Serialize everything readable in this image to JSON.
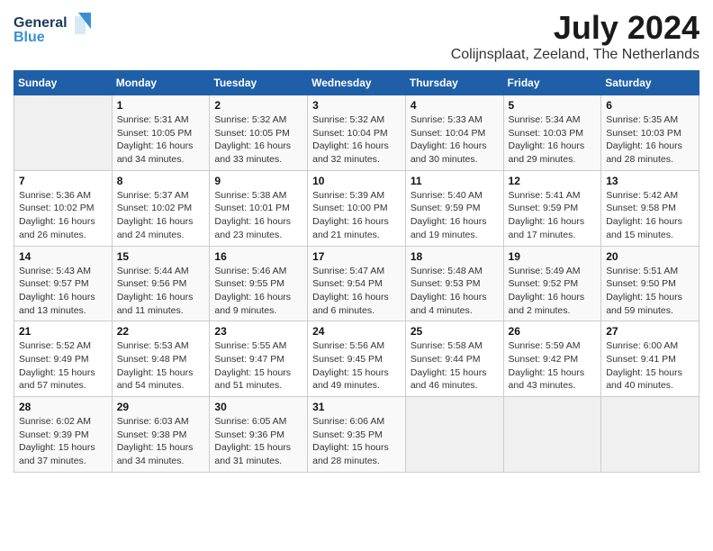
{
  "header": {
    "logo_general": "General",
    "logo_blue": "Blue",
    "title": "July 2024",
    "subtitle": "Colijnsplaat, Zeeland, The Netherlands"
  },
  "calendar": {
    "days_of_week": [
      "Sunday",
      "Monday",
      "Tuesday",
      "Wednesday",
      "Thursday",
      "Friday",
      "Saturday"
    ],
    "weeks": [
      [
        {
          "day": "",
          "info": ""
        },
        {
          "day": "1",
          "info": "Sunrise: 5:31 AM\nSunset: 10:05 PM\nDaylight: 16 hours\nand 34 minutes."
        },
        {
          "day": "2",
          "info": "Sunrise: 5:32 AM\nSunset: 10:05 PM\nDaylight: 16 hours\nand 33 minutes."
        },
        {
          "day": "3",
          "info": "Sunrise: 5:32 AM\nSunset: 10:04 PM\nDaylight: 16 hours\nand 32 minutes."
        },
        {
          "day": "4",
          "info": "Sunrise: 5:33 AM\nSunset: 10:04 PM\nDaylight: 16 hours\nand 30 minutes."
        },
        {
          "day": "5",
          "info": "Sunrise: 5:34 AM\nSunset: 10:03 PM\nDaylight: 16 hours\nand 29 minutes."
        },
        {
          "day": "6",
          "info": "Sunrise: 5:35 AM\nSunset: 10:03 PM\nDaylight: 16 hours\nand 28 minutes."
        }
      ],
      [
        {
          "day": "7",
          "info": "Sunrise: 5:36 AM\nSunset: 10:02 PM\nDaylight: 16 hours\nand 26 minutes."
        },
        {
          "day": "8",
          "info": "Sunrise: 5:37 AM\nSunset: 10:02 PM\nDaylight: 16 hours\nand 24 minutes."
        },
        {
          "day": "9",
          "info": "Sunrise: 5:38 AM\nSunset: 10:01 PM\nDaylight: 16 hours\nand 23 minutes."
        },
        {
          "day": "10",
          "info": "Sunrise: 5:39 AM\nSunset: 10:00 PM\nDaylight: 16 hours\nand 21 minutes."
        },
        {
          "day": "11",
          "info": "Sunrise: 5:40 AM\nSunset: 9:59 PM\nDaylight: 16 hours\nand 19 minutes."
        },
        {
          "day": "12",
          "info": "Sunrise: 5:41 AM\nSunset: 9:59 PM\nDaylight: 16 hours\nand 17 minutes."
        },
        {
          "day": "13",
          "info": "Sunrise: 5:42 AM\nSunset: 9:58 PM\nDaylight: 16 hours\nand 15 minutes."
        }
      ],
      [
        {
          "day": "14",
          "info": "Sunrise: 5:43 AM\nSunset: 9:57 PM\nDaylight: 16 hours\nand 13 minutes."
        },
        {
          "day": "15",
          "info": "Sunrise: 5:44 AM\nSunset: 9:56 PM\nDaylight: 16 hours\nand 11 minutes."
        },
        {
          "day": "16",
          "info": "Sunrise: 5:46 AM\nSunset: 9:55 PM\nDaylight: 16 hours\nand 9 minutes."
        },
        {
          "day": "17",
          "info": "Sunrise: 5:47 AM\nSunset: 9:54 PM\nDaylight: 16 hours\nand 6 minutes."
        },
        {
          "day": "18",
          "info": "Sunrise: 5:48 AM\nSunset: 9:53 PM\nDaylight: 16 hours\nand 4 minutes."
        },
        {
          "day": "19",
          "info": "Sunrise: 5:49 AM\nSunset: 9:52 PM\nDaylight: 16 hours\nand 2 minutes."
        },
        {
          "day": "20",
          "info": "Sunrise: 5:51 AM\nSunset: 9:50 PM\nDaylight: 15 hours\nand 59 minutes."
        }
      ],
      [
        {
          "day": "21",
          "info": "Sunrise: 5:52 AM\nSunset: 9:49 PM\nDaylight: 15 hours\nand 57 minutes."
        },
        {
          "day": "22",
          "info": "Sunrise: 5:53 AM\nSunset: 9:48 PM\nDaylight: 15 hours\nand 54 minutes."
        },
        {
          "day": "23",
          "info": "Sunrise: 5:55 AM\nSunset: 9:47 PM\nDaylight: 15 hours\nand 51 minutes."
        },
        {
          "day": "24",
          "info": "Sunrise: 5:56 AM\nSunset: 9:45 PM\nDaylight: 15 hours\nand 49 minutes."
        },
        {
          "day": "25",
          "info": "Sunrise: 5:58 AM\nSunset: 9:44 PM\nDaylight: 15 hours\nand 46 minutes."
        },
        {
          "day": "26",
          "info": "Sunrise: 5:59 AM\nSunset: 9:42 PM\nDaylight: 15 hours\nand 43 minutes."
        },
        {
          "day": "27",
          "info": "Sunrise: 6:00 AM\nSunset: 9:41 PM\nDaylight: 15 hours\nand 40 minutes."
        }
      ],
      [
        {
          "day": "28",
          "info": "Sunrise: 6:02 AM\nSunset: 9:39 PM\nDaylight: 15 hours\nand 37 minutes."
        },
        {
          "day": "29",
          "info": "Sunrise: 6:03 AM\nSunset: 9:38 PM\nDaylight: 15 hours\nand 34 minutes."
        },
        {
          "day": "30",
          "info": "Sunrise: 6:05 AM\nSunset: 9:36 PM\nDaylight: 15 hours\nand 31 minutes."
        },
        {
          "day": "31",
          "info": "Sunrise: 6:06 AM\nSunset: 9:35 PM\nDaylight: 15 hours\nand 28 minutes."
        },
        {
          "day": "",
          "info": ""
        },
        {
          "day": "",
          "info": ""
        },
        {
          "day": "",
          "info": ""
        }
      ]
    ]
  }
}
